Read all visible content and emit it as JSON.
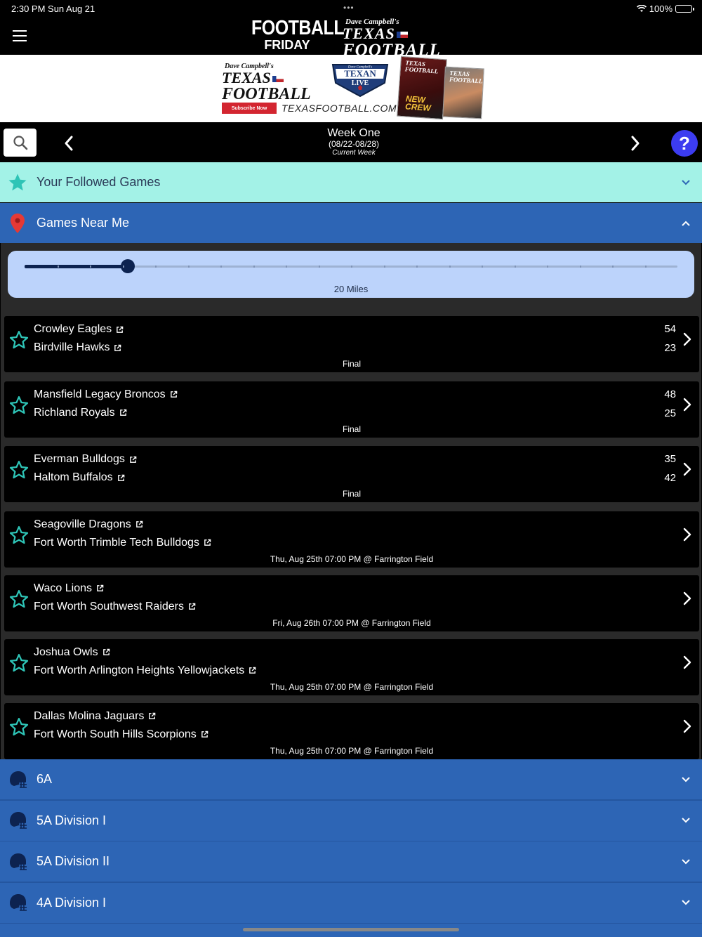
{
  "status_bar": {
    "time": "2:30 PM   Sun Aug 21",
    "battery": "100%"
  },
  "header": {
    "logo_ff_line1": "FOOTBALL",
    "logo_ff_line2": "FRIDAY",
    "logo_tf_sig": "Dave Campbell's",
    "logo_tf_line1": "TEXAS",
    "logo_tf_line2": "FOOTBALL"
  },
  "ad": {
    "sig": "Dave Campbell's",
    "line1": "TEXAS",
    "line2": "FOOTBALL",
    "subscribe": "Subscribe Now",
    "url": "TEXASFOOTBALL.COM",
    "texan_live_sig": "Dave Campbell's",
    "texan_live_1": "TEXAN",
    "texan_live_2": "LIVE",
    "mag1_title": "TEXAS FOOTBALL",
    "mag1_crew": "NEW CREW",
    "mag2_title": "TEXAS FOOTBALL"
  },
  "week_nav": {
    "title": "Week One",
    "range": "(08/22-08/28)",
    "current": "Current Week",
    "help": "?"
  },
  "sections": {
    "followed": "Your Followed Games",
    "near": "Games Near Me"
  },
  "slider": {
    "label": "20 Miles",
    "value_fraction": 0.158,
    "steps": 20
  },
  "games": [
    {
      "team1": "Crowley Eagles",
      "team2": "Birdville Hawks",
      "score1": "54",
      "score2": "23",
      "info": "Final"
    },
    {
      "team1": "Mansfield Legacy Broncos",
      "team2": "Richland Royals",
      "score1": "48",
      "score2": "25",
      "info": "Final"
    },
    {
      "team1": "Everman Bulldogs",
      "team2": "Haltom Buffalos",
      "score1": "35",
      "score2": "42",
      "info": "Final"
    },
    {
      "team1": "Seagoville Dragons",
      "team2": "Fort Worth Trimble Tech Bulldogs",
      "score1": "",
      "score2": "",
      "info": "Thu, Aug 25th 07:00 PM @ Farrington Field"
    },
    {
      "team1": "Waco Lions",
      "team2": "Fort Worth Southwest Raiders",
      "score1": "",
      "score2": "",
      "info": "Fri, Aug 26th 07:00 PM @ Farrington Field"
    },
    {
      "team1": "Joshua Owls",
      "team2": "Fort Worth Arlington Heights Yellowjackets",
      "score1": "",
      "score2": "",
      "info": "Thu, Aug 25th 07:00 PM @ Farrington Field"
    },
    {
      "team1": "Dallas Molina Jaguars",
      "team2": "Fort Worth South Hills Scorpions",
      "score1": "",
      "score2": "",
      "info": "Thu, Aug 25th 07:00 PM @ Farrington Field"
    }
  ],
  "groups": [
    "6A",
    "5A Division I",
    "5A Division II",
    "4A Division I"
  ],
  "colors": {
    "followed_bg": "#a3f2e7",
    "section_bg": "#2d65b5",
    "star": "#2ec4b6",
    "pin": "#e53935",
    "help": "#3c3cf0"
  }
}
